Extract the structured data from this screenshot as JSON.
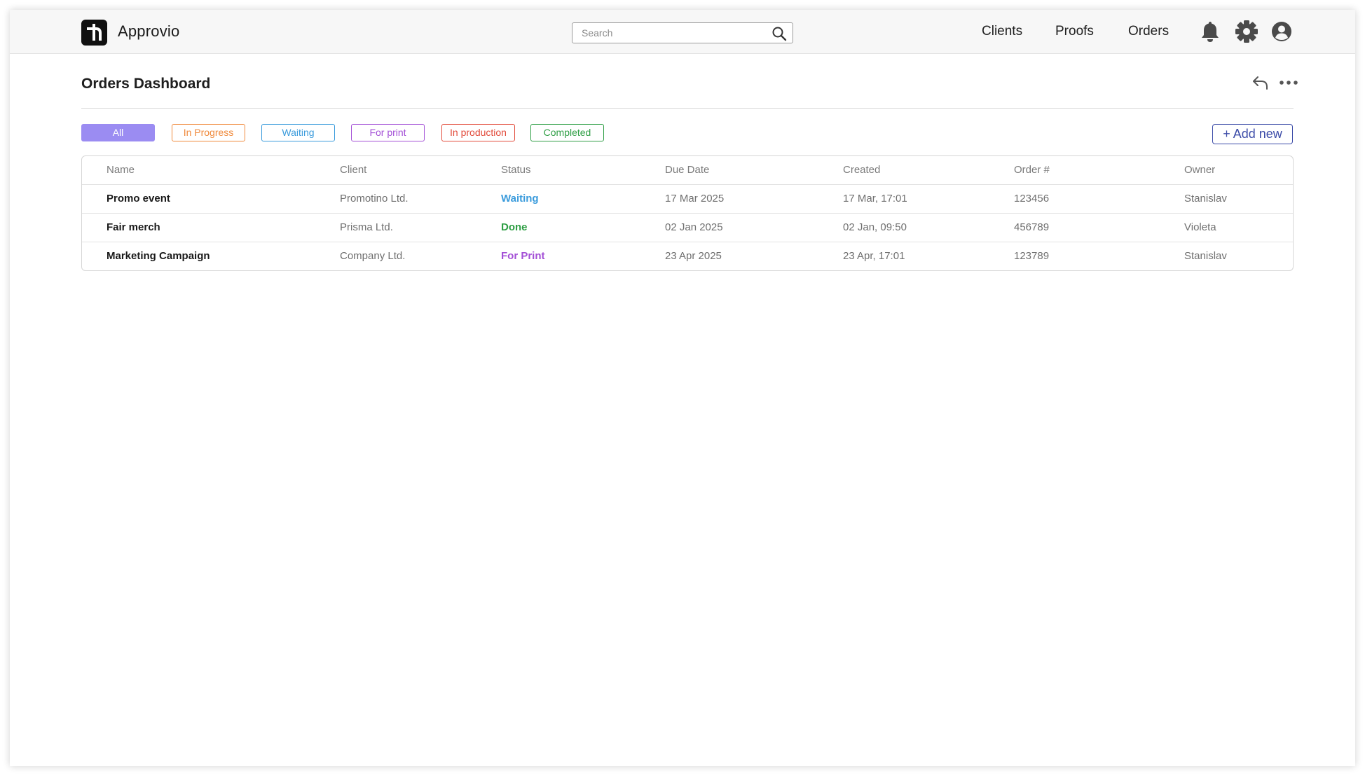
{
  "app": {
    "name": "Approvio"
  },
  "search": {
    "placeholder": "Search",
    "value": ""
  },
  "nav": {
    "links": [
      "Clients",
      "Proofs",
      "Orders"
    ],
    "icons": [
      "bell-icon",
      "gear-icon",
      "user-icon"
    ]
  },
  "page": {
    "title": "Orders Dashboard",
    "actions": [
      "reply-icon",
      "more-icon"
    ]
  },
  "filters": [
    {
      "label": "All",
      "color": "#9b8cf2",
      "active": true
    },
    {
      "label": "In Progress",
      "color": "#f08a3c",
      "active": false
    },
    {
      "label": "Waiting",
      "color": "#3a9bdc",
      "active": false
    },
    {
      "label": "For print",
      "color": "#a34fd6",
      "active": false
    },
    {
      "label": "In production",
      "color": "#e24b3b",
      "active": false
    },
    {
      "label": "Completed",
      "color": "#2e9e44",
      "active": false
    }
  ],
  "add_new_label": "+ Add new",
  "table": {
    "columns": [
      "Name",
      "Client",
      "Status",
      "Due Date",
      "Created",
      "Order #",
      "Owner"
    ],
    "rows": [
      {
        "name": "Promo event",
        "client": "Promotino Ltd.",
        "status": "Waiting",
        "status_color": "#3a9bdc",
        "due": "17 Mar 2025",
        "created": "17 Mar, 17:01",
        "order": "123456",
        "owner": "Stanislav"
      },
      {
        "name": "Fair merch",
        "client": "Prisma Ltd.",
        "status": "Done",
        "status_color": "#2e9e44",
        "due": "02 Jan 2025",
        "created": "02 Jan, 09:50",
        "order": "456789",
        "owner": "Violeta"
      },
      {
        "name": "Marketing Campaign",
        "client": "Company Ltd.",
        "status": "For Print",
        "status_color": "#a34fd6",
        "due": "23 Apr 2025",
        "created": "23 Apr, 17:01",
        "order": "123789",
        "owner": "Stanislav"
      }
    ]
  }
}
